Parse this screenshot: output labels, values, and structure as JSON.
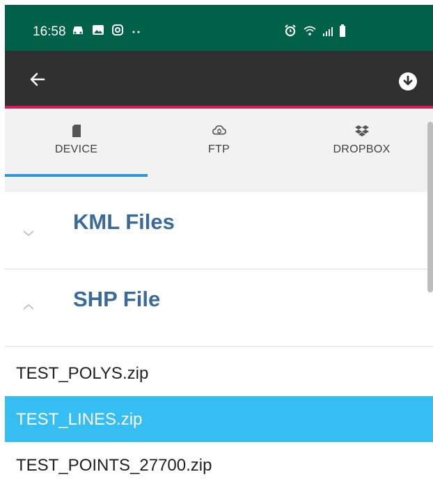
{
  "status_bar": {
    "time": "16:58",
    "icons_left": [
      "car-icon",
      "image-icon",
      "instagram-icon",
      "more-dots-icon"
    ],
    "icons_right": [
      "alarm-icon",
      "wifi-icon",
      "signal-icon",
      "battery-icon"
    ],
    "bg_color": "#006149"
  },
  "app_bar": {
    "back_icon": "arrow-left-icon",
    "action_icon": "download-icon",
    "bg_color": "#303030",
    "accent_color": "#d81b60"
  },
  "tabs": [
    {
      "label": "DEVICE",
      "icon": "sd-card-icon",
      "selected": true
    },
    {
      "label": "FTP",
      "icon": "cloud-sync-icon",
      "selected": false
    },
    {
      "label": "DROPBOX",
      "icon": "dropbox-icon",
      "selected": false
    }
  ],
  "groups": [
    {
      "title": "KML Files",
      "expanded": false
    },
    {
      "title": "SHP File",
      "expanded": true
    }
  ],
  "files": [
    {
      "name": "TEST_POLYS.zip",
      "selected": false
    },
    {
      "name": "TEST_LINES.zip",
      "selected": true
    },
    {
      "name": "TEST_POINTS_27700.zip",
      "selected": false
    }
  ],
  "colors": {
    "accent": "#2d96d8",
    "selection": "#36bdf2",
    "group_title": "#3a6a99"
  }
}
